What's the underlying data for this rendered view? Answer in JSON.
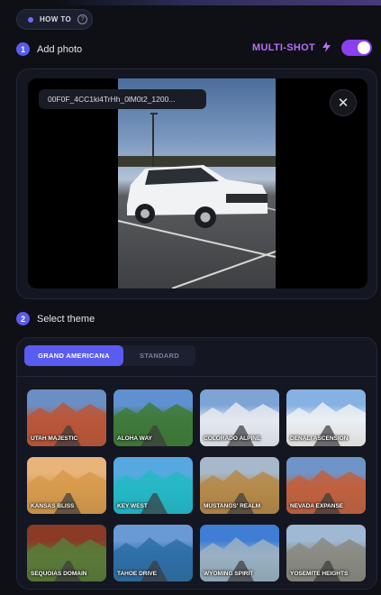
{
  "howto": {
    "label": "HOW TO",
    "help_glyph": "?"
  },
  "step1": {
    "number": "1",
    "label": "Add photo"
  },
  "multishot": {
    "label": "MULTI-SHOT",
    "icon": "lightning-bolt-icon",
    "enabled": true
  },
  "photo": {
    "filename": "00F0F_4CC1ki4TrHh_0lM0t2_1200...",
    "close_glyph": "✕"
  },
  "step2": {
    "number": "2",
    "label": "Select theme"
  },
  "tabs": [
    {
      "label": "GRAND AMERICANA",
      "active": true
    },
    {
      "label": "STANDARD",
      "active": false
    }
  ],
  "themes": [
    {
      "name": "UTAH MAJESTIC",
      "top": "#6a8fc4",
      "mid": "#b8573a",
      "bot": "#7a3e25"
    },
    {
      "name": "ALOHA WAY",
      "top": "#5f90d0",
      "mid": "#3f7a3a",
      "bot": "#2d5a2a"
    },
    {
      "name": "COLORADO ALPINE",
      "top": "#7ea4d6",
      "mid": "#e4e8ef",
      "bot": "#7b7f86"
    },
    {
      "name": "DENALI ASCENSION",
      "top": "#86b1e2",
      "mid": "#eaeef3",
      "bot": "#8c6a3a"
    },
    {
      "name": "KANSAS BLISS",
      "top": "#e8b47a",
      "mid": "#d79a4c",
      "bot": "#4f5a3a"
    },
    {
      "name": "KEY WEST",
      "top": "#56a9e0",
      "mid": "#26b7c4",
      "bot": "#1a6f8c"
    },
    {
      "name": "MUSTANGS' REALM",
      "top": "#a6b8c9",
      "mid": "#b58a4a",
      "bot": "#5a4a30"
    },
    {
      "name": "NEVADA EXPANSE",
      "top": "#6f95c8",
      "mid": "#c0603e",
      "bot": "#5d5550"
    },
    {
      "name": "SEQUOIAS DOMAIN",
      "top": "#8a3a26",
      "mid": "#5a7a3a",
      "bot": "#2f4a2a"
    },
    {
      "name": "TAHOE DRIVE",
      "top": "#6a9ad6",
      "mid": "#2e6fa8",
      "bot": "#2d4a3a"
    },
    {
      "name": "WYOMING SPIRIT",
      "top": "#3f7ed4",
      "mid": "#9ab0c4",
      "bot": "#3a5a3a"
    },
    {
      "name": "YOSEMITE HEIGHTS",
      "top": "#9fb8d4",
      "mid": "#8a8a82",
      "bot": "#3a4a30"
    }
  ]
}
